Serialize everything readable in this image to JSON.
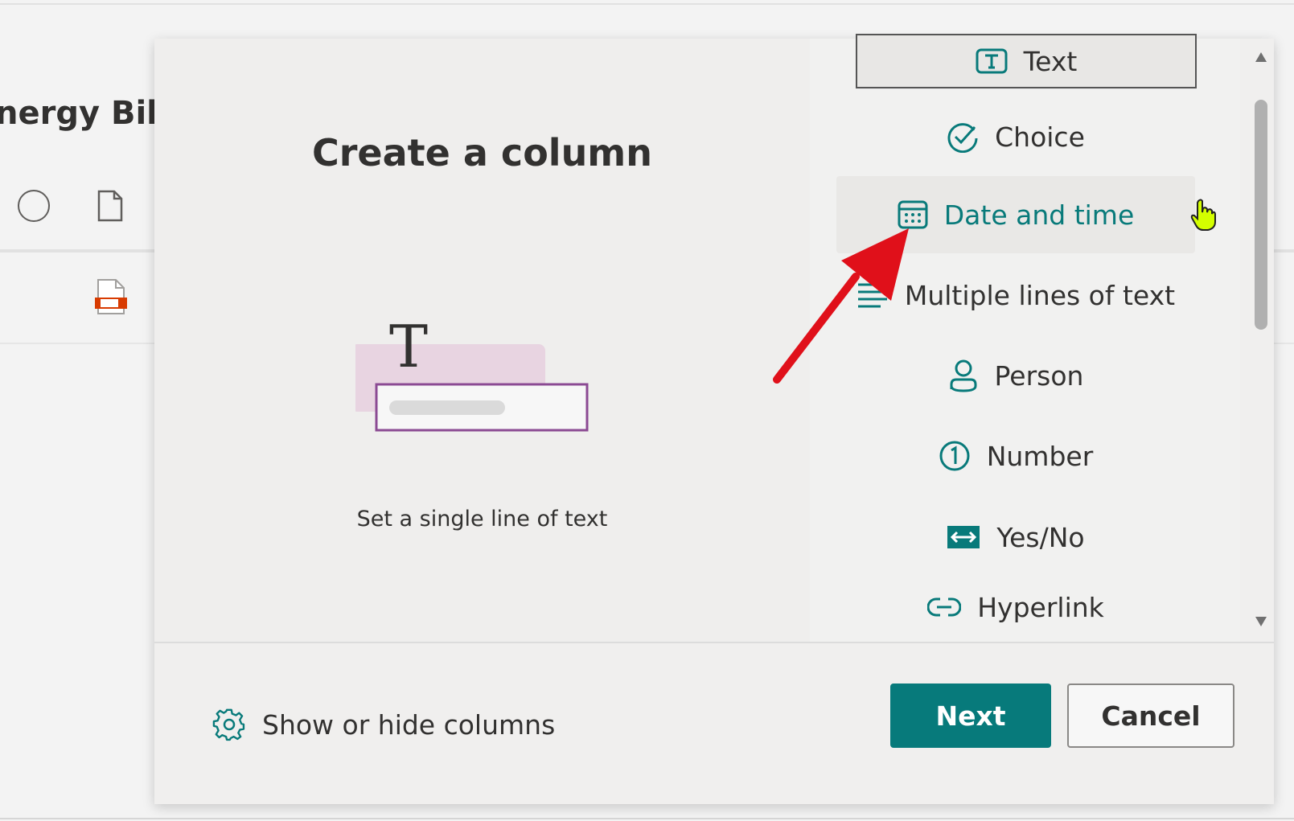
{
  "background": {
    "list_title": "nergy Bills"
  },
  "dialog": {
    "title": "Create a column",
    "description": "Set a single line of text",
    "column_types": [
      {
        "label": "Text",
        "icon": "text-box-icon",
        "state": "selected"
      },
      {
        "label": "Choice",
        "icon": "check-circle-icon",
        "state": "normal"
      },
      {
        "label": "Date and time",
        "icon": "calendar-icon",
        "state": "hover"
      },
      {
        "label": "Multiple lines of text",
        "icon": "lines-icon",
        "state": "normal"
      },
      {
        "label": "Person",
        "icon": "person-icon",
        "state": "normal"
      },
      {
        "label": "Number",
        "icon": "number-one-icon",
        "state": "normal"
      },
      {
        "label": "Yes/No",
        "icon": "toggle-icon",
        "state": "normal"
      },
      {
        "label": "Hyperlink",
        "icon": "link-icon",
        "state": "normal"
      }
    ],
    "show_hide_label": "Show or hide columns",
    "next_label": "Next",
    "cancel_label": "Cancel"
  },
  "colors": {
    "accent": "#077a7b",
    "annotation_arrow": "#e0101a",
    "cursor": "#d4ff00"
  }
}
